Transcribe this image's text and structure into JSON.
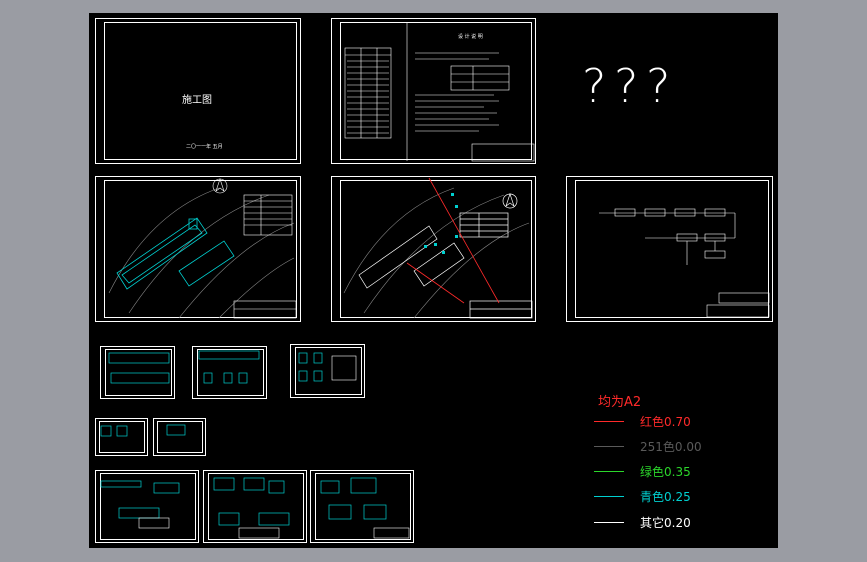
{
  "sheets": {
    "cover": {
      "title": "施工图",
      "date": "二〇一一年 五月"
    },
    "notes": {
      "heading": "设 计 说 明"
    }
  },
  "question_marks": [
    "?",
    "?",
    "?"
  ],
  "legend": {
    "heading": "均为A2",
    "rows": [
      {
        "label": "红色0.70",
        "color": "#ff2a2a"
      },
      {
        "label": "251色0.00",
        "color": "#5a5a5a"
      },
      {
        "label": "绿色0.35",
        "color": "#2bd62b"
      },
      {
        "label": "青色0.25",
        "color": "#00d0d0"
      },
      {
        "label": "其它0.20",
        "color": "#ffffff"
      }
    ]
  }
}
